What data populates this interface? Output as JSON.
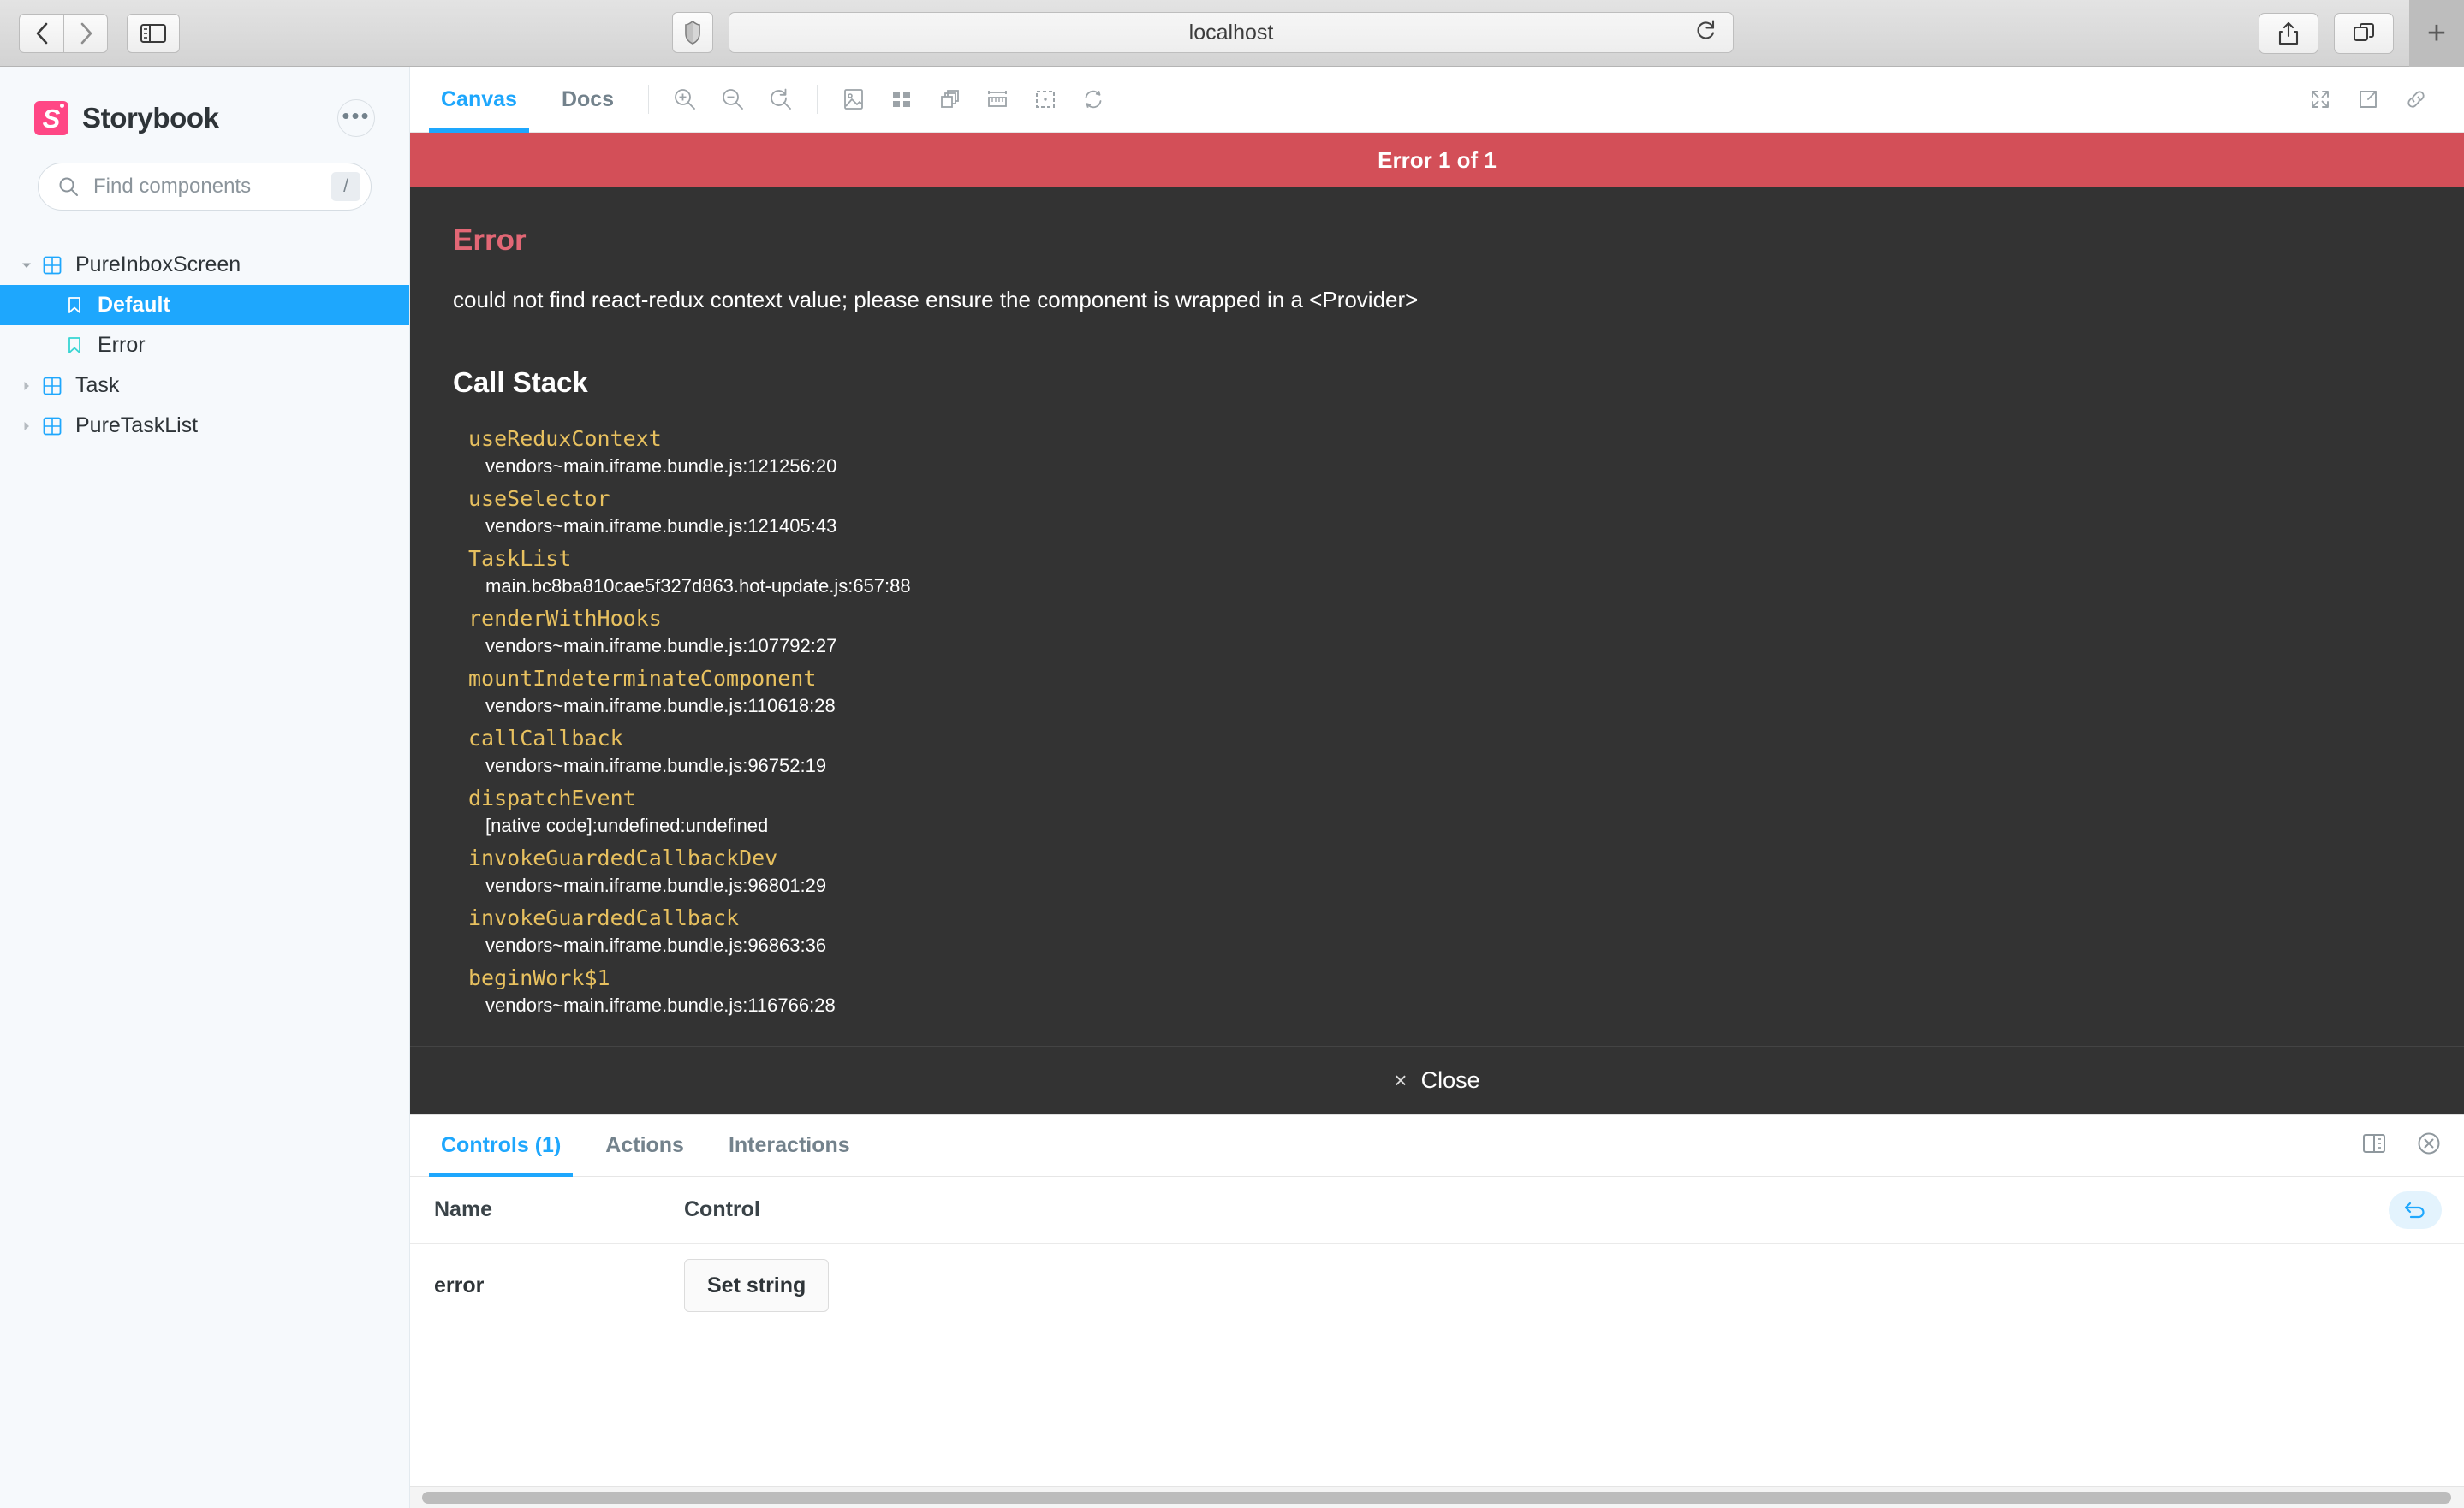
{
  "browser": {
    "back_label": "‹",
    "forward_label": "›",
    "sidebar_toggle_name": "sidebar-toggle",
    "url": "localhost",
    "shield_icon": "shield-icon",
    "reload_icon": "reload-icon",
    "share_icon": "share-icon",
    "tabs_icon": "tabs-overview-icon",
    "newtab_label": "+"
  },
  "sidebar": {
    "logo_letter": "S",
    "brand": "Storybook",
    "menu_label": "•••",
    "search": {
      "placeholder": "Find components",
      "shortcut": "/",
      "icon": "search-icon"
    },
    "tree": [
      {
        "label": "PureInboxScreen",
        "depth": 1,
        "kind": "component",
        "expanded": true,
        "selected": false
      },
      {
        "label": "Default",
        "depth": 2,
        "kind": "story",
        "expanded": false,
        "selected": true
      },
      {
        "label": "Error",
        "depth": 2,
        "kind": "story",
        "expanded": false,
        "selected": false
      },
      {
        "label": "Task",
        "depth": 1,
        "kind": "component",
        "expanded": false,
        "selected": false
      },
      {
        "label": "PureTaskList",
        "depth": 1,
        "kind": "component",
        "expanded": false,
        "selected": false
      }
    ]
  },
  "toolbar": {
    "tabs": [
      {
        "label": "Canvas",
        "active": true
      },
      {
        "label": "Docs",
        "active": false
      }
    ],
    "icons": [
      "zoom-in-icon",
      "zoom-out-icon",
      "zoom-reset-icon",
      "background-image-icon",
      "grid-icon",
      "measure-layers-icon",
      "ruler-icon",
      "outline-icon",
      "refresh-icon"
    ],
    "right_icons": [
      "fullscreen-icon",
      "open-in-new-tab-icon",
      "copy-link-icon"
    ]
  },
  "error_overlay": {
    "banner": "Error 1 of 1",
    "title": "Error",
    "message": "could not find react-redux context value; please ensure the component is wrapped in a <Provider>",
    "stack_title": "Call Stack",
    "close_label": "Close",
    "close_icon": "close-icon",
    "banner_color": "#d34f58",
    "body_color": "#333333",
    "title_color": "#e26775",
    "function_color": "#e8c15f",
    "frames": [
      {
        "fn": "useReduxContext",
        "loc": "vendors~main.iframe.bundle.js:121256:20"
      },
      {
        "fn": "useSelector",
        "loc": "vendors~main.iframe.bundle.js:121405:43"
      },
      {
        "fn": "TaskList",
        "loc": "main.bc8ba810cae5f327d863.hot-update.js:657:88"
      },
      {
        "fn": "renderWithHooks",
        "loc": "vendors~main.iframe.bundle.js:107792:27"
      },
      {
        "fn": "mountIndeterminateComponent",
        "loc": "vendors~main.iframe.bundle.js:110618:28"
      },
      {
        "fn": "callCallback",
        "loc": "vendors~main.iframe.bundle.js:96752:19"
      },
      {
        "fn": "dispatchEvent",
        "loc": "[native code]:undefined:undefined"
      },
      {
        "fn": "invokeGuardedCallbackDev",
        "loc": "vendors~main.iframe.bundle.js:96801:29"
      },
      {
        "fn": "invokeGuardedCallback",
        "loc": "vendors~main.iframe.bundle.js:96863:36"
      },
      {
        "fn": "beginWork$1",
        "loc": "vendors~main.iframe.bundle.js:116766:28"
      }
    ]
  },
  "addons": {
    "tabs": [
      {
        "label": "Controls (1)",
        "active": true
      },
      {
        "label": "Actions",
        "active": false
      },
      {
        "label": "Interactions",
        "active": false
      }
    ],
    "right_icons": [
      "panel-position-icon",
      "close-panel-icon"
    ],
    "table": {
      "columns": [
        "Name",
        "Control"
      ],
      "reset_icon": "reset-controls-icon",
      "rows": [
        {
          "name": "error",
          "control_label": "Set string"
        }
      ]
    }
  },
  "accent": {
    "blue": "#1ea7fd",
    "pink": "#ff4785"
  }
}
